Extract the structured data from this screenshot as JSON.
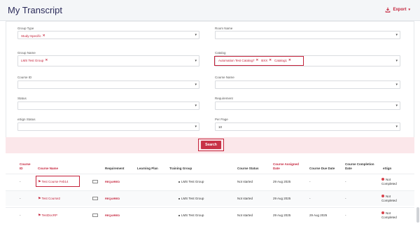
{
  "header": {
    "title": "My Transcript",
    "export_label": "Export",
    "export_icon": "download-icon"
  },
  "filters": {
    "group_type": {
      "label": "Group Type",
      "chips": [
        "Study-Specific"
      ]
    },
    "group_name": {
      "label": "Group Name",
      "chips": [
        "LMS Test Group"
      ]
    },
    "course_id": {
      "label": "Course ID",
      "value": ""
    },
    "status": {
      "label": "Status",
      "value": ""
    },
    "esign_status": {
      "label": "eSign Status",
      "value": ""
    },
    "room_name": {
      "label": "Room Name",
      "value": ""
    },
    "catalog": {
      "label": "Catalog",
      "chips": [
        "Automation Test Catalog7",
        "BXX",
        "Catalog1"
      ]
    },
    "course_name": {
      "label": "Course Name",
      "value": ""
    },
    "requirement": {
      "label": "Requirement",
      "value": ""
    },
    "per_page": {
      "label": "Per Page",
      "value": "10"
    },
    "search_label": "Search",
    "chip_remove": "✕"
  },
  "table": {
    "headers": {
      "course_id": "Course ID",
      "course_name": "Course Name",
      "requirement": "Requirement",
      "learning_plan": "Learning Plan",
      "training_group": "Training Group",
      "course_status": "Course Status",
      "assigned_date": "Course Assigned Date",
      "due_date": "Course Due Date",
      "completion_date": "Course Completion Date",
      "esign": "eSign"
    },
    "rows": [
      {
        "course_id": "-",
        "course_name": "Test Course Feb14",
        "requirement": "REQUIRED",
        "learning_plan": "",
        "training_group": "LMS Test Group",
        "course_status": "Not started",
        "assigned_date": "29 Aug 2025",
        "due_date": "-",
        "completion_date": "-",
        "esign": "Not Completed"
      },
      {
        "course_id": "-",
        "course_name": "Test Course2",
        "requirement": "REQUIRED",
        "learning_plan": "",
        "training_group": "LMS Test Group",
        "course_status": "Not started",
        "assigned_date": "29 Aug 2025",
        "due_date": "-",
        "completion_date": "-",
        "esign": "Not Completed"
      },
      {
        "course_id": "-",
        "course_name": "TestDocRP",
        "requirement": "REQUIRED",
        "learning_plan": "",
        "training_group": "LMS Test Group",
        "course_status": "Not started",
        "assigned_date": "29 Aug 2025",
        "due_date": "29 Aug 2025",
        "completion_date": "-",
        "esign": "Not Completed"
      }
    ]
  },
  "colors": {
    "accent": "#c4223a",
    "title": "#2b2b5a",
    "search_band": "#fbe7ea"
  }
}
